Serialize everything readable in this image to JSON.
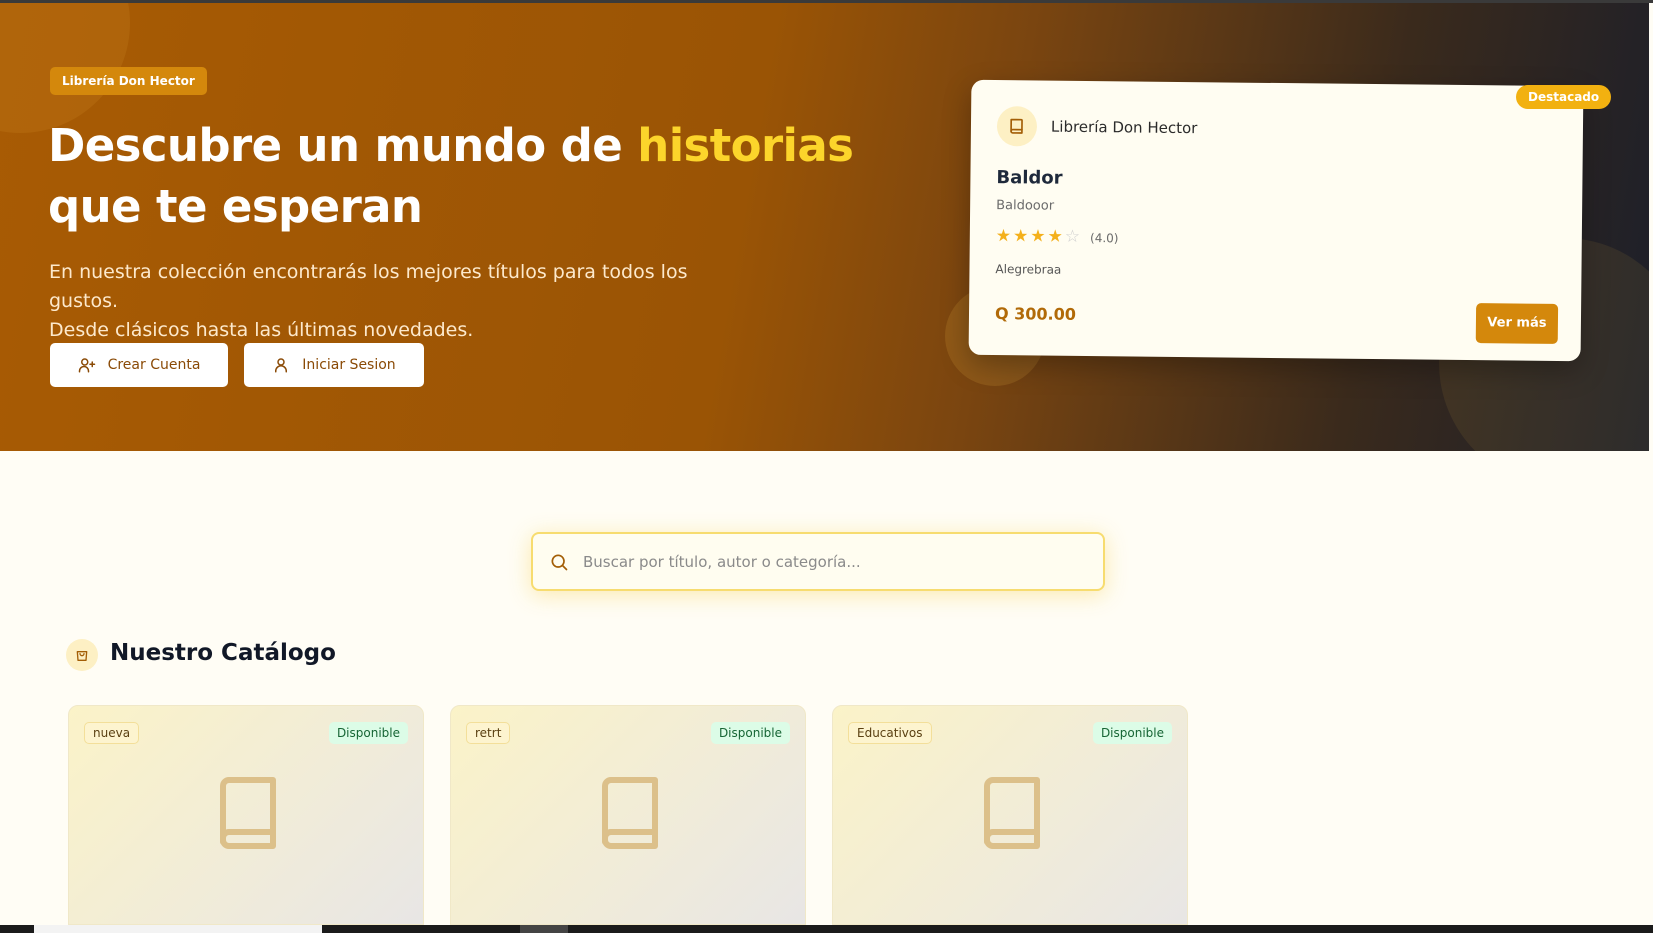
{
  "hero": {
    "brand_badge": "Librería Don Hector",
    "title_part1": "Descubre un mundo de ",
    "title_highlight": "historias",
    "title_part2": "que te esperan",
    "subtitle_line1": "En nuestra colección encontrarás los mejores títulos para todos los gustos.",
    "subtitle_line2": "Desde clásicos hasta las últimas novedades.",
    "create_account_label": "Crear Cuenta",
    "login_label": "Iniciar Sesion"
  },
  "featured": {
    "tag": "Destacado",
    "store_name": "Librería Don Hector",
    "book_title": "Baldor",
    "author": "Baldooor",
    "rating": 4,
    "rating_text": "(4.0)",
    "category": "Alegrebraa",
    "price": "Q 300.00",
    "more_label": "Ver más"
  },
  "search": {
    "placeholder": "Buscar por título, autor o categoría...",
    "value": ""
  },
  "catalog": {
    "title": "Nuestro Catálogo",
    "books": [
      {
        "category": "nueva",
        "status": "Disponible"
      },
      {
        "category": "retrt",
        "status": "Disponible"
      },
      {
        "category": "Educativos",
        "status": "Disponible"
      }
    ]
  },
  "colors": {
    "accent": "#d4880c",
    "highlight": "#fcd52b",
    "status_bg": "#dcfce7",
    "status_text": "#166534"
  }
}
